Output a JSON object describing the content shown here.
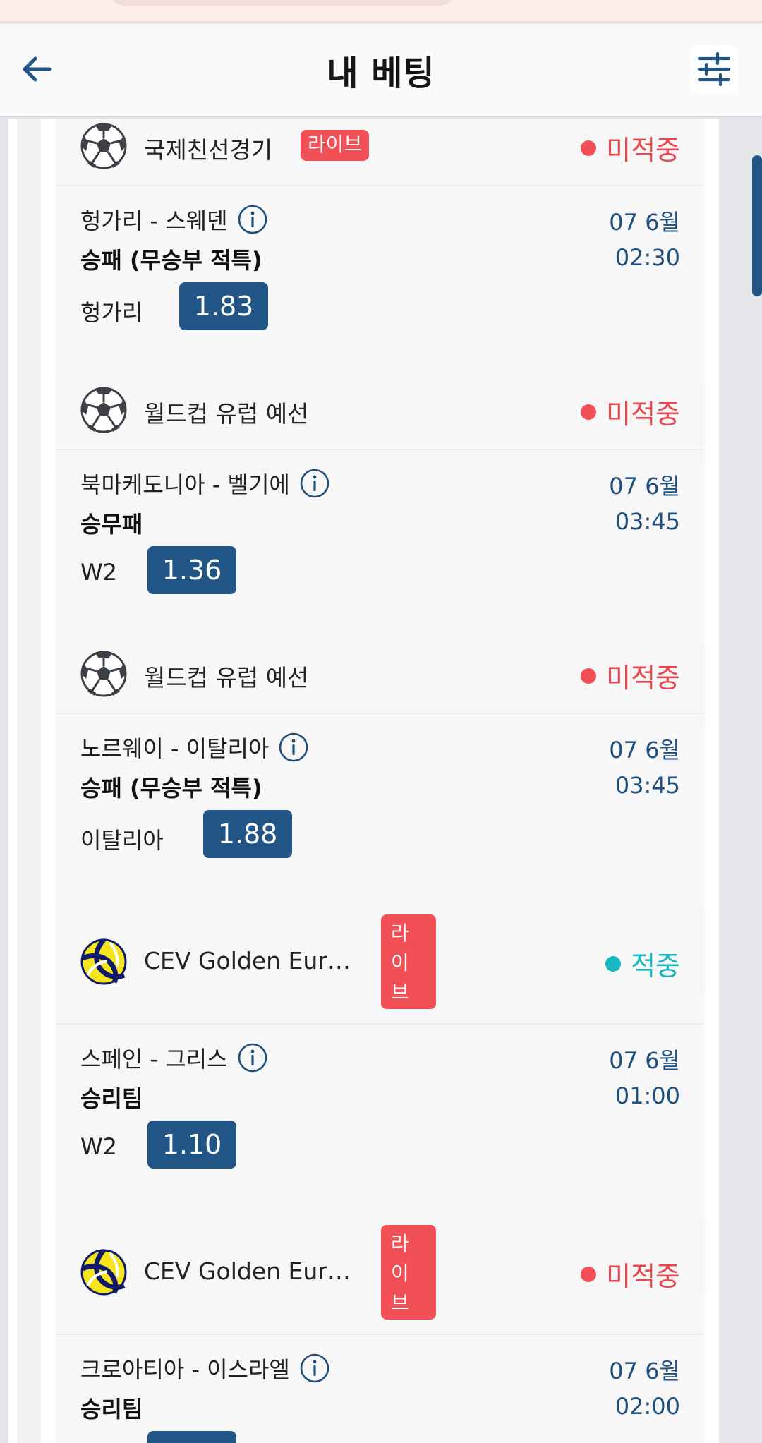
{
  "header": {
    "title": "내 베팅"
  },
  "colors": {
    "accent": "#215586",
    "live": "#f24f56",
    "lost": "#e8474d",
    "won": "#16b7be"
  },
  "bets": [
    {
      "sport_icon": "soccer-ball-icon",
      "league": "국제친선경기",
      "live_label": "라이브",
      "status": "미적중",
      "match": "헝가리 - 스웨덴",
      "market": "승패 (무승부 적특)",
      "pick": "헝가리",
      "odds": "1.83",
      "date": "07 6월",
      "time": "02:30"
    },
    {
      "sport_icon": "soccer-ball-icon",
      "league": "월드컵 유럽 예선",
      "status": "미적중",
      "match": "북마케도니아 - 벨기에",
      "market": "승무패",
      "pick": "W2",
      "odds": "1.36",
      "date": "07 6월",
      "time": "03:45"
    },
    {
      "sport_icon": "soccer-ball-icon",
      "league": "월드컵 유럽 예선",
      "status": "미적중",
      "match": "노르웨이 - 이탈리아",
      "market": "승패 (무승부 적특)",
      "pick": "이탈리아",
      "odds": "1.88",
      "date": "07 6월",
      "time": "03:45"
    },
    {
      "sport_icon": "volleyball-icon",
      "league": "CEV Golden Eur…",
      "live_label": [
        "라",
        "이",
        "브"
      ],
      "status": "적중",
      "match": "스페인 - 그리스",
      "market": "승리팀",
      "pick": "W2",
      "odds": "1.10",
      "date": "07 6월",
      "time": "01:00"
    },
    {
      "sport_icon": "volleyball-icon",
      "league": "CEV Golden Eur…",
      "live_label": [
        "라",
        "이",
        "브"
      ],
      "status": "미적중",
      "match": "크로아티아 - 이스라엘",
      "market": "승리팀",
      "date": "07 6월",
      "time": "02:00"
    }
  ]
}
